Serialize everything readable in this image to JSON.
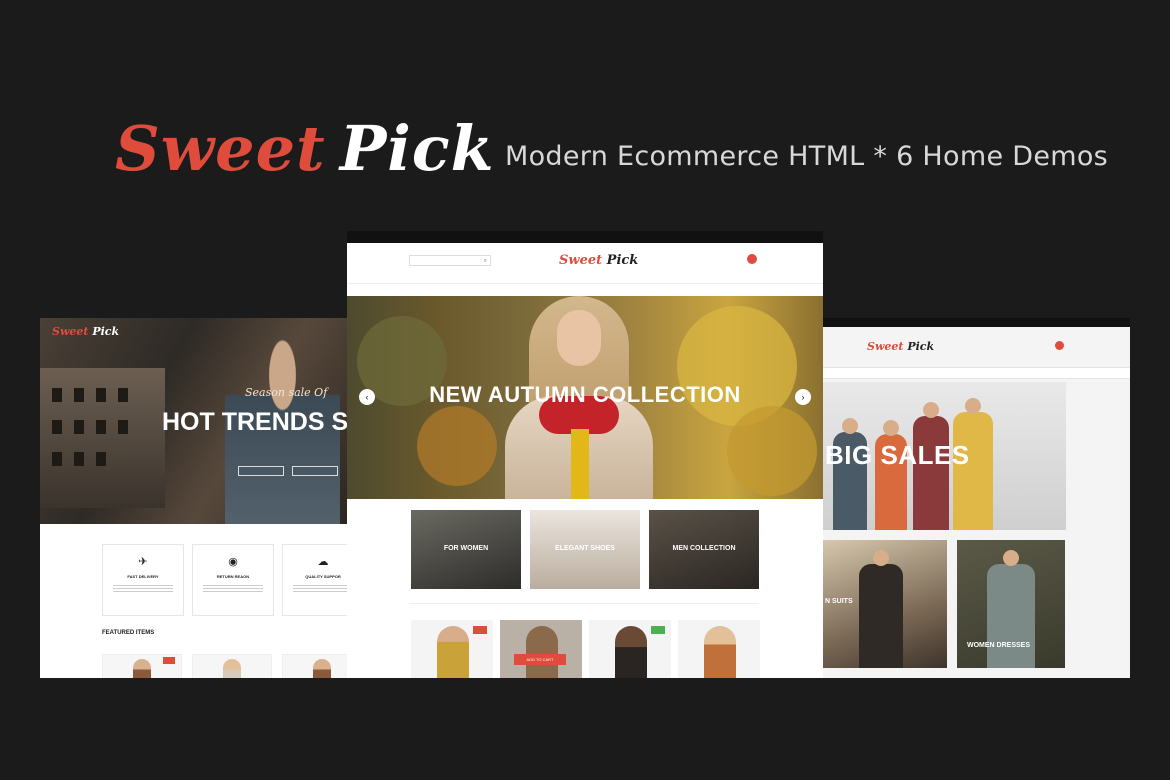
{
  "banner": {
    "brand_part1": "Sweet",
    "brand_part2": "Pick",
    "tagline": "Modern Ecommerce HTML * 6 Home Demos"
  },
  "colors": {
    "background": "#1b1b1b",
    "accent": "#e04c3c",
    "tagline": "#d8d8d8"
  },
  "left_demo": {
    "logo_part1": "Sweet",
    "logo_part2": "Pick",
    "hero_subtitle": "Season sale Of",
    "hero_title": "HOT TRENDS SA",
    "features": [
      {
        "icon": "airplane-icon",
        "glyph": "✈",
        "title": "FAST DELIVERY"
      },
      {
        "icon": "eye-icon",
        "glyph": "◉",
        "title": "RETURN REAON"
      },
      {
        "icon": "chat-icon",
        "glyph": "☁",
        "title": "QUALITY SUPPOR"
      }
    ],
    "section_title": "FEATURED ITEMS"
  },
  "center_demo": {
    "logo_part1": "Sweet",
    "logo_part2": "Pick",
    "hero_title": "NEW AUTUMN COLLECTION",
    "categories": [
      {
        "label": "FOR WOMEN"
      },
      {
        "label": "ELEGANT SHOES"
      },
      {
        "label": "MEN COLLECTION"
      }
    ],
    "add_to_cart": "ADD TO CART"
  },
  "right_demo": {
    "logo_part1": "Sweet",
    "logo_part2": "Pick",
    "hero_title": "BIG SALES",
    "tiles": [
      {
        "label": "N SUITS"
      },
      {
        "label": "WOMEN DRESSES"
      }
    ]
  }
}
